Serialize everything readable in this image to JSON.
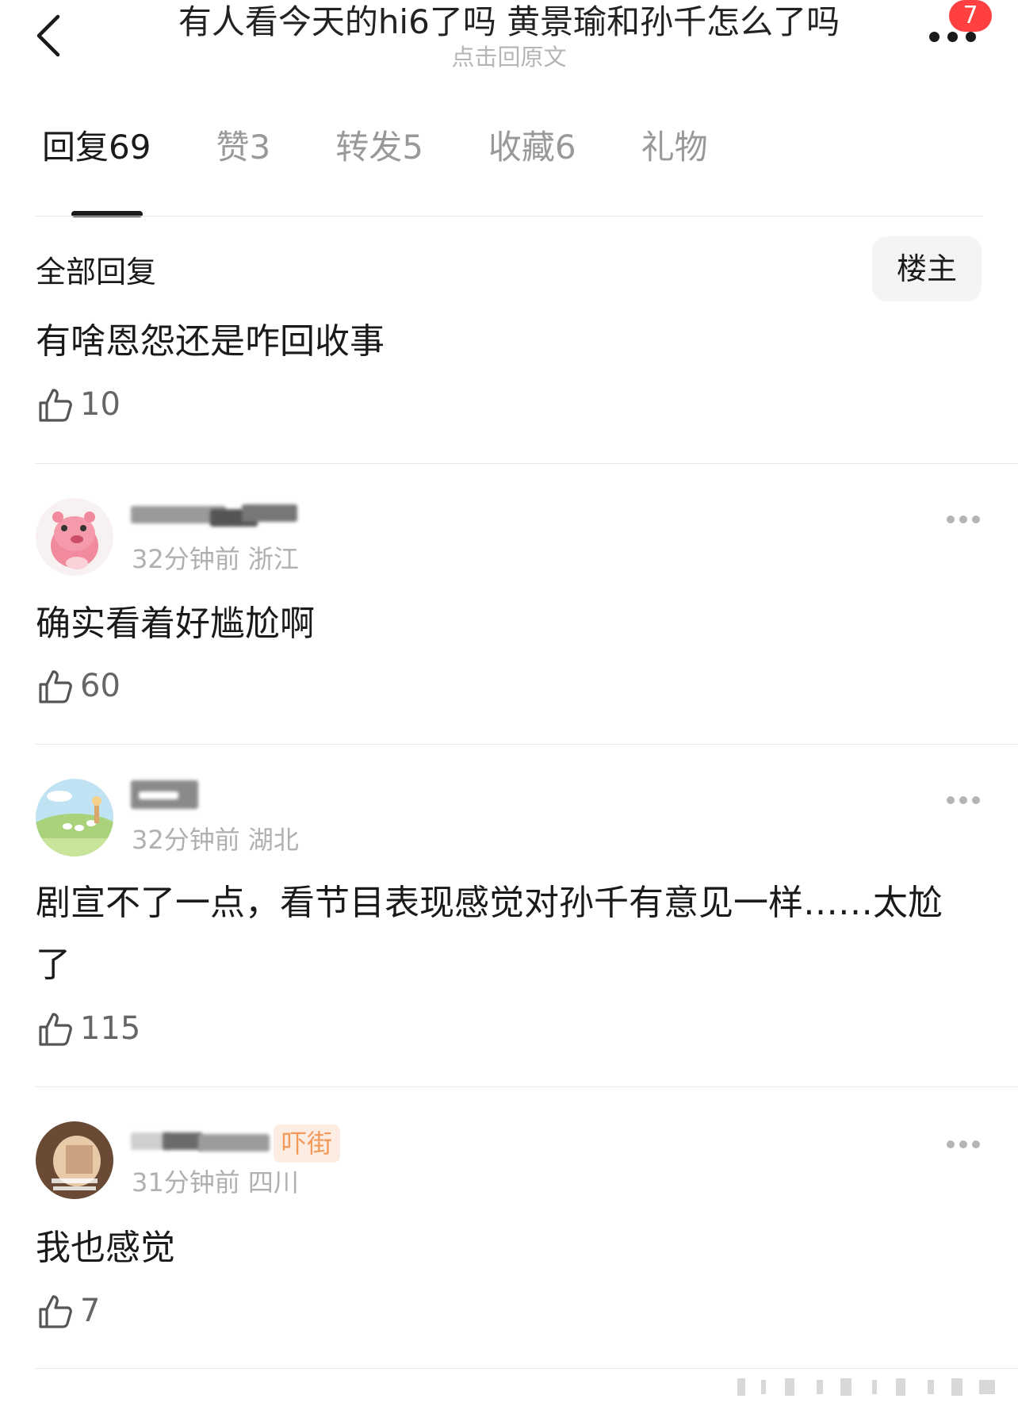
{
  "header": {
    "title": "有人看今天的hi6了吗  黄景瑜和孙千怎么了吗",
    "subtitle": "点击回原文",
    "notification_count": "7"
  },
  "tabs": [
    {
      "label": "回复69",
      "active": true
    },
    {
      "label": "赞3",
      "active": false
    },
    {
      "label": "转发5",
      "active": false
    },
    {
      "label": "收藏6",
      "active": false
    },
    {
      "label": "礼物",
      "active": false
    }
  ],
  "section": {
    "title": "全部回复",
    "op_filter_label": "楼主"
  },
  "comments": [
    {
      "text": "有啥恩怨还是咋回收事",
      "likes": "10"
    },
    {
      "meta": "32分钟前 浙江",
      "text": "确实看着好尴尬啊",
      "likes": "60"
    },
    {
      "meta": "32分钟前 湖北",
      "text": "剧宣不了一点，看节目表现感觉对孙千有意见一样……太尬了",
      "likes": "115"
    },
    {
      "tag": "吓街",
      "meta": "31分钟前 四川",
      "text": "我也感觉",
      "likes": "7"
    }
  ],
  "colors": {
    "badge": "#ff4040",
    "tag_bg": "#fdece2",
    "tag_text": "#f39a5a",
    "muted_text": "#b0b0b0"
  },
  "icons": {
    "back": "chevron-left-icon",
    "more": "more-dots-icon",
    "like": "thumbs-up-icon"
  }
}
